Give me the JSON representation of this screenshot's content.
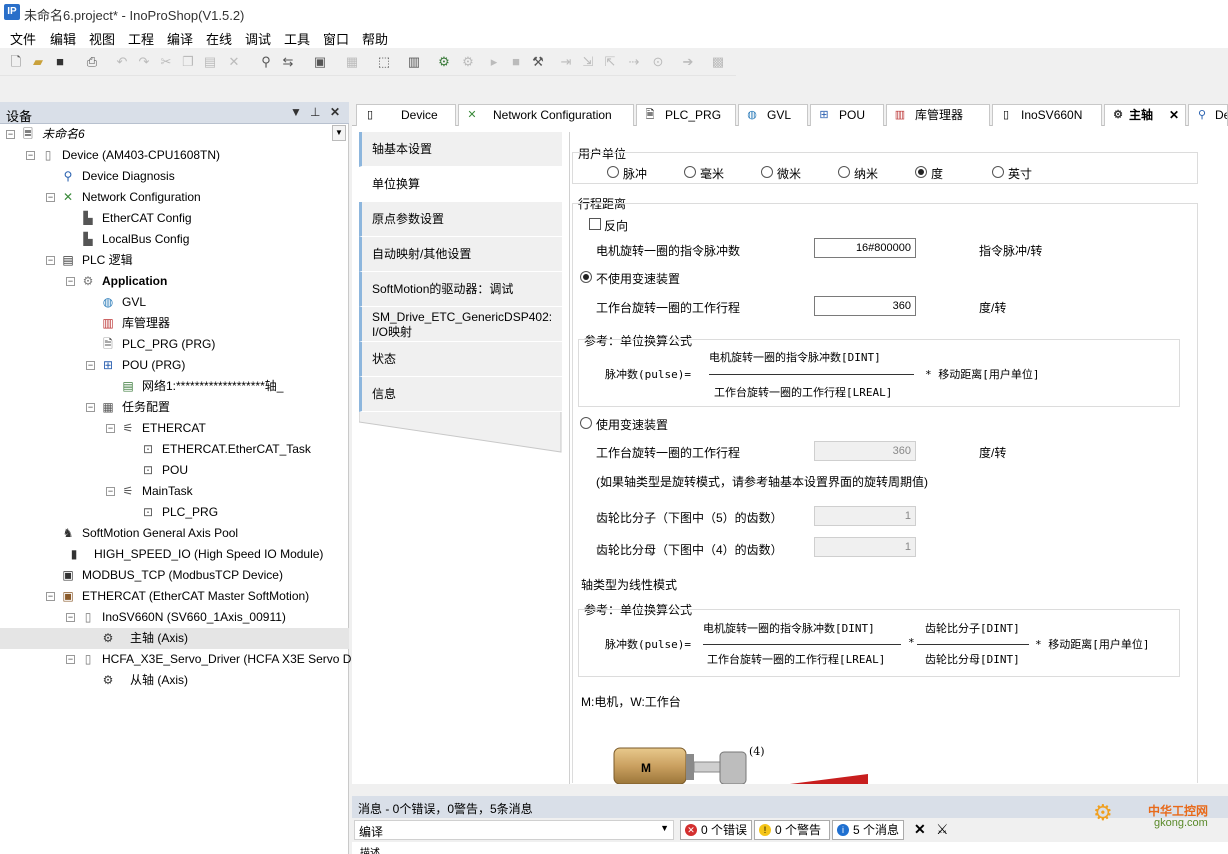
{
  "window": {
    "title": "未命名6.project* - InoProShop(V1.5.2)"
  },
  "menu": [
    "文件",
    "编辑",
    "视图",
    "工程",
    "编译",
    "在线",
    "调试",
    "工具",
    "窗口",
    "帮助"
  ],
  "devices_panel": {
    "title": "设备",
    "tree": [
      {
        "label": "未命名6"
      },
      {
        "label": "Device (AM403-CPU1608TN)"
      },
      {
        "label": "Device Diagnosis"
      },
      {
        "label": "Network Configuration"
      },
      {
        "label": "EtherCAT Config"
      },
      {
        "label": "LocalBus Config"
      },
      {
        "label": "PLC 逻辑"
      },
      {
        "label": "Application"
      },
      {
        "label": "GVL"
      },
      {
        "label": "库管理器"
      },
      {
        "label": "PLC_PRG (PRG)"
      },
      {
        "label": "POU (PRG)"
      },
      {
        "label": "网络1:*******************轴_"
      },
      {
        "label": "任务配置"
      },
      {
        "label": "ETHERCAT"
      },
      {
        "label": "ETHERCAT.EtherCAT_Task"
      },
      {
        "label": "POU"
      },
      {
        "label": "MainTask"
      },
      {
        "label": "PLC_PRG"
      },
      {
        "label": "SoftMotion General Axis Pool"
      },
      {
        "label": "HIGH_SPEED_IO (High Speed IO Module)"
      },
      {
        "label": "MODBUS_TCP (ModbusTCP Device)"
      },
      {
        "label": "ETHERCAT (EtherCAT Master SoftMotion)"
      },
      {
        "label": "InoSV660N (SV660_1Axis_00911)"
      },
      {
        "label": "主轴 (Axis)"
      },
      {
        "label": "HCFA_X3E_Servo_Driver (HCFA X3E Servo Driver)"
      },
      {
        "label": "从轴 (Axis)"
      }
    ]
  },
  "tabs": [
    "Device",
    "Network Configuration",
    "PLC_PRG",
    "GVL",
    "POU",
    "库管理器",
    "InoSV660N",
    "主轴",
    "De"
  ],
  "axis_nav": [
    "轴基本设置",
    "单位换算",
    "原点参数设置",
    "自动映射/其他设置",
    "SoftMotion的驱动器：调试",
    "SM_Drive_ETC_GenericDSP402: I/O映射",
    "状态",
    "信息"
  ],
  "units": {
    "title": "用户单位",
    "options": [
      "脉冲",
      "毫米",
      "微米",
      "纳米",
      "度",
      "英寸"
    ],
    "selected": "度"
  },
  "travel": {
    "title": "行程距离",
    "reverse_label": "反向",
    "motor_pulses_label": "电机旋转一圈的指令脉冲数",
    "motor_pulses_value": "16#800000",
    "motor_pulses_unit": "指令脉冲/转",
    "no_gear_label": "不使用变速装置",
    "table_travel_label": "工作台旋转一圈的工作行程",
    "table_travel_value": "360",
    "table_travel_unit": "度/转",
    "ref_title": "参考：单位换算公式",
    "formula_lhs": "脉冲数(pulse)=",
    "formula_num": "电机旋转一圈的指令脉冲数[DINT]",
    "formula_den": "工作台旋转一圈的工作行程[LREAL]",
    "formula_rhs": "* 移动距离[用户单位]",
    "gear_label": "使用变速装置",
    "gear_travel_label": "工作台旋转一圈的工作行程",
    "gear_travel_value": "360",
    "gear_travel_unit": "度/转",
    "gear_note": "(如果轴类型是旋转模式，请参考轴基本设置界面的旋转周期值)",
    "gear_num_label": "齿轮比分子（下图中（5）的齿数）",
    "gear_num_value": "1",
    "gear_den_label": "齿轮比分母（下图中（4）的齿数）",
    "gear_den_value": "1",
    "linear_title": "轴类型为线性模式",
    "ref2_title": "参考：单位换算公式",
    "f2_lhs": "脉冲数(pulse)=",
    "f2_num": "电机旋转一圈的指令脉冲数[DINT]",
    "f2_den": "工作台旋转一圈的工作行程[LREAL]",
    "f2_mul": "*",
    "f2_gnum": "齿轮比分子[DINT]",
    "f2_gden": "齿轮比分母[DINT]",
    "f2_rhs": "* 移动距离[用户单位]",
    "legend": "M:电机，W:工作台",
    "diagram_motor": "M",
    "diagram_gear": "(4)"
  },
  "messages": {
    "header": "消息 - 0个错误，0警告，5条消息",
    "category": "编译",
    "errors": "0 个错误",
    "warnings": "0 个警告",
    "infos": "5 个消息",
    "desc_col": "描述"
  },
  "watermark": {
    "line1": "中华工控网",
    "line2": "gkong.com"
  }
}
